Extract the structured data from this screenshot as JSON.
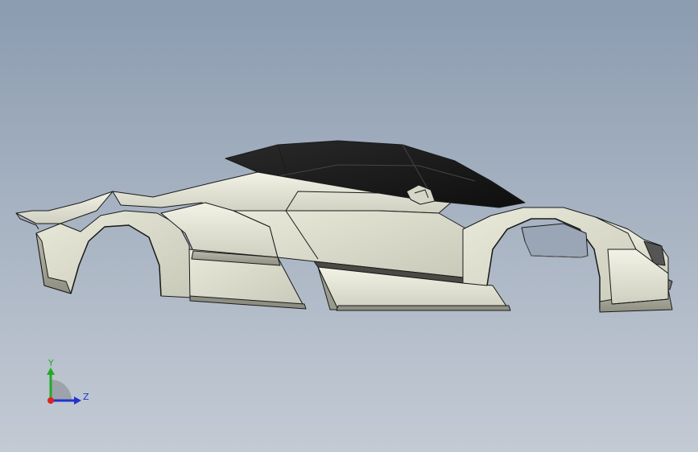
{
  "viewport": {
    "background_top": "#8b9bb0",
    "background_bottom": "#c3cad4"
  },
  "model": {
    "body_color": "#e6e6d6",
    "shade_color": "#a9aa9b",
    "canopy_color": "#1f1f1f",
    "edge_color": "#1a1a1a"
  },
  "triad": {
    "y_label": "Y",
    "z_label": "Z",
    "y_color": "#22aa22",
    "z_color": "#2233cc",
    "x_color": "#dd2222"
  }
}
